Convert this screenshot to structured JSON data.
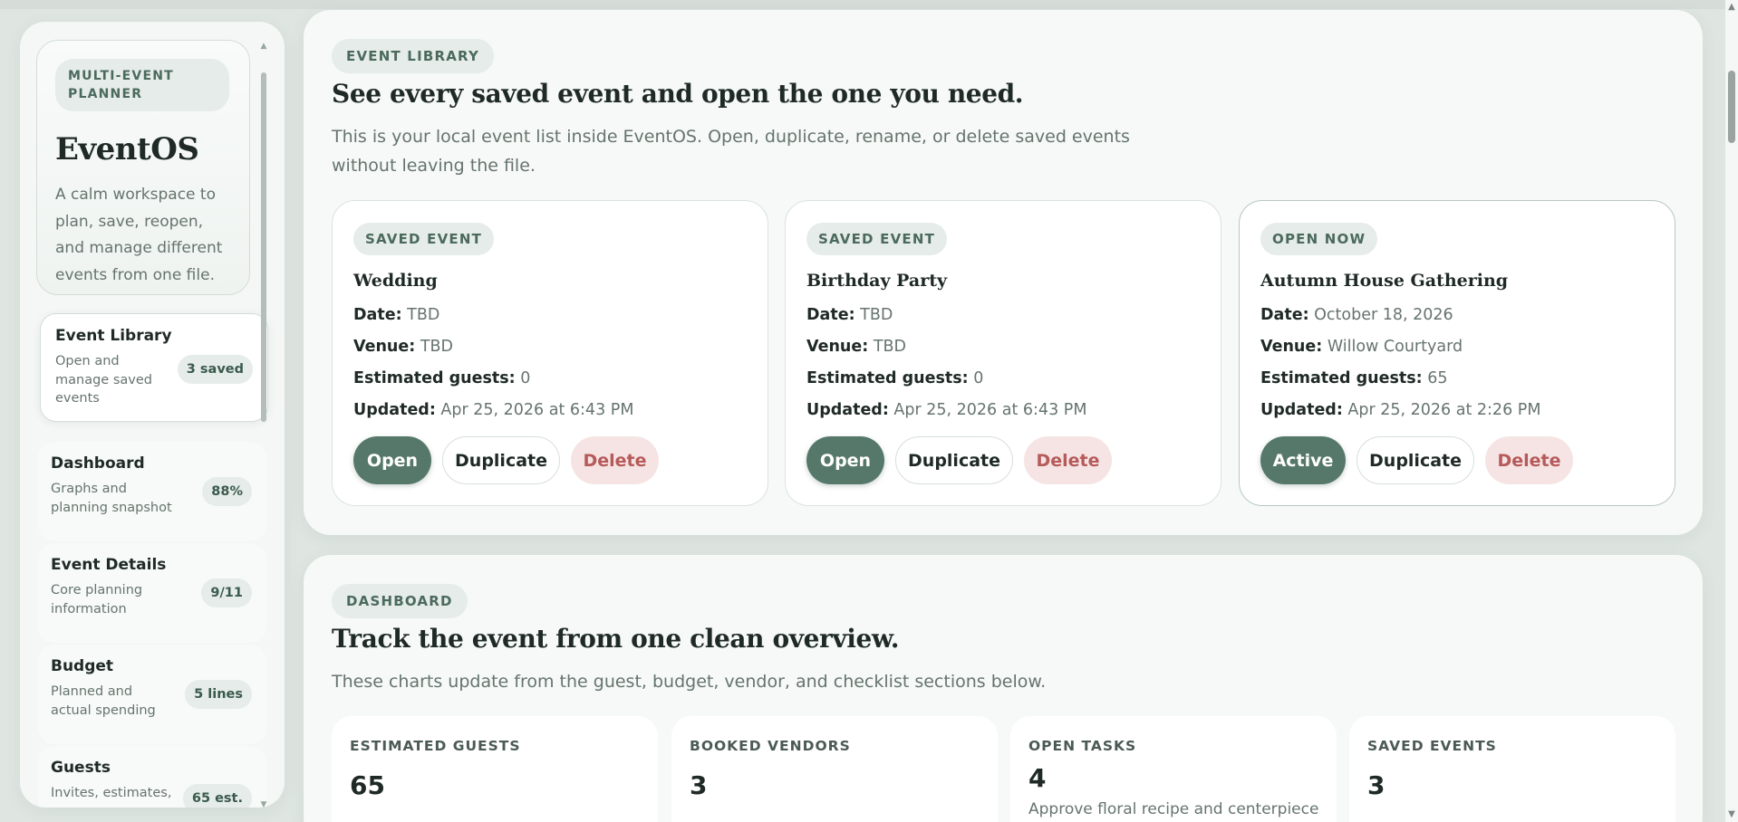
{
  "sidebar": {
    "brand": {
      "pill": "MULTI-EVENT PLANNER",
      "title": "EventOS",
      "description": "A calm workspace to plan, save, reopen, and manage different events from one file."
    },
    "items": [
      {
        "title": "Event Library",
        "sub": "Open and manage saved events",
        "badge": "3 saved"
      },
      {
        "title": "Dashboard",
        "sub": "Graphs and planning snapshot",
        "badge": "88%"
      },
      {
        "title": "Event Details",
        "sub": "Core planning information",
        "badge": "9/11"
      },
      {
        "title": "Budget",
        "sub": "Planned and actual spending",
        "badge": "5 lines"
      },
      {
        "title": "Guests",
        "sub": "Invites, estimates,",
        "badge": "65 est."
      }
    ]
  },
  "library": {
    "pill": "EVENT LIBRARY",
    "title": "See every saved event and open the one you need.",
    "description": "This is your local event list inside EventOS. Open, duplicate, rename, or delete saved events without leaving the file.",
    "labels": {
      "date": "Date:",
      "venue": "Venue:",
      "guests": "Estimated guests:",
      "updated": "Updated:"
    },
    "events": [
      {
        "status": "SAVED EVENT",
        "name": "Wedding",
        "date": "TBD",
        "venue": "TBD",
        "guests": "0",
        "updated": "Apr 25, 2026 at 6:43 PM",
        "primary": "Open",
        "duplicate": "Duplicate",
        "delete": "Delete"
      },
      {
        "status": "SAVED EVENT",
        "name": "Birthday Party",
        "date": "TBD",
        "venue": "TBD",
        "guests": "0",
        "updated": "Apr 25, 2026 at 6:43 PM",
        "primary": "Open",
        "duplicate": "Duplicate",
        "delete": "Delete"
      },
      {
        "status": "OPEN NOW",
        "name": "Autumn House Gathering",
        "date": "October 18, 2026",
        "venue": "Willow Courtyard",
        "guests": "65",
        "updated": "Apr 25, 2026 at 2:26 PM",
        "primary": "Active",
        "duplicate": "Duplicate",
        "delete": "Delete"
      }
    ]
  },
  "dashboard": {
    "pill": "DASHBOARD",
    "title": "Track the event from one clean overview.",
    "description": "These charts update from the guest, budget, vendor, and checklist sections below.",
    "stats": [
      {
        "label": "ESTIMATED GUESTS",
        "value": "65"
      },
      {
        "label": "BOOKED VENDORS",
        "value": "3"
      },
      {
        "label": "OPEN TASKS",
        "value": "4",
        "note": "Approve floral recipe and centerpiece"
      },
      {
        "label": "SAVED EVENTS",
        "value": "3"
      }
    ]
  },
  "colors": {
    "accent": "#56786a",
    "danger": "#b65a5a",
    "background": "#dfe6e2"
  }
}
